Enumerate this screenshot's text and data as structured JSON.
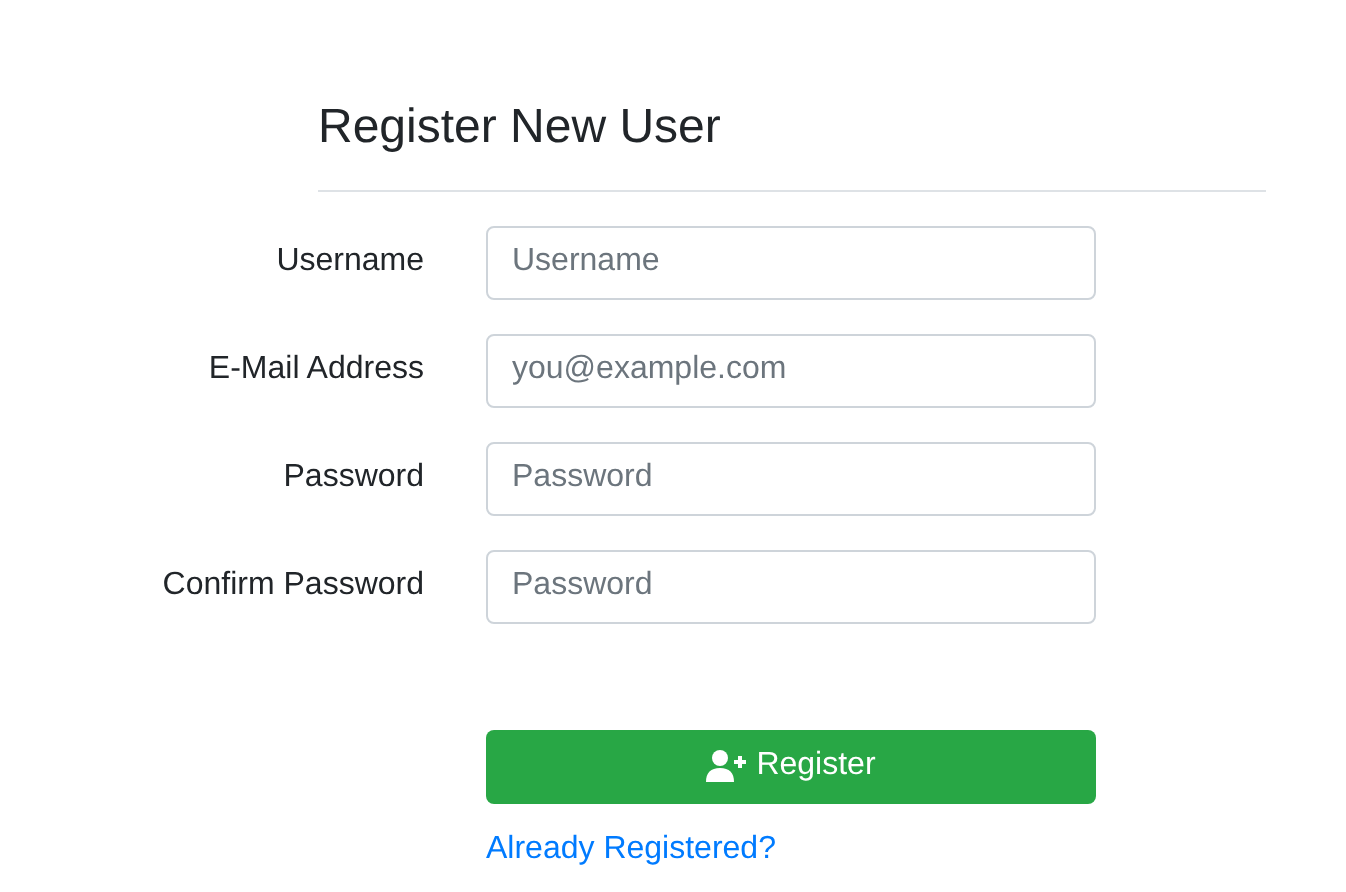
{
  "title": "Register New User",
  "fields": [
    {
      "label": "Username",
      "placeholder": "Username"
    },
    {
      "label": "E-Mail Address",
      "placeholder": "you@example.com"
    },
    {
      "label": "Password",
      "placeholder": "Password"
    },
    {
      "label": "Confirm Password",
      "placeholder": "Password"
    }
  ],
  "submit_button": "Register",
  "login_link": "Already Registered?"
}
